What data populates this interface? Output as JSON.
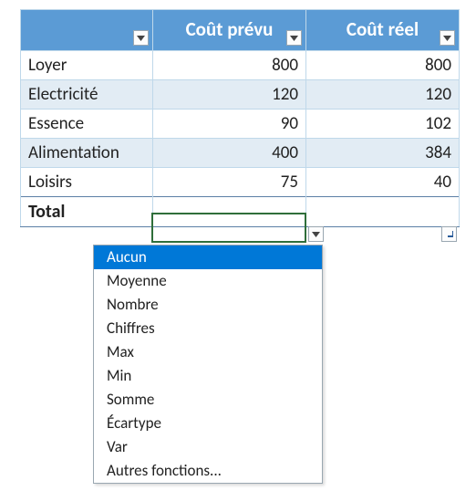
{
  "header": {
    "col_category": "",
    "col_planned": "Coût prévu",
    "col_actual": "Coût réel"
  },
  "rows": [
    {
      "label": "Loyer",
      "planned": "800",
      "actual": "800"
    },
    {
      "label": "Electricité",
      "planned": "120",
      "actual": "120"
    },
    {
      "label": "Essence",
      "planned": "90",
      "actual": "102"
    },
    {
      "label": "Alimentation",
      "planned": "400",
      "actual": "384"
    },
    {
      "label": "Loisirs",
      "planned": "75",
      "actual": "40"
    }
  ],
  "total": {
    "label": "Total",
    "planned": "",
    "actual": ""
  },
  "dropdown": {
    "selected_index": 0,
    "options": [
      "Aucun",
      "Moyenne",
      "Nombre",
      "Chiffres",
      "Max",
      "Min",
      "Somme",
      "Écartype",
      "Var",
      "Autres fonctions..."
    ]
  },
  "colors": {
    "header_bg": "#5b9bd5",
    "band_bg": "#e2ecf4",
    "selection_border": "#2f6e3a",
    "menu_highlight": "#0078d7"
  }
}
